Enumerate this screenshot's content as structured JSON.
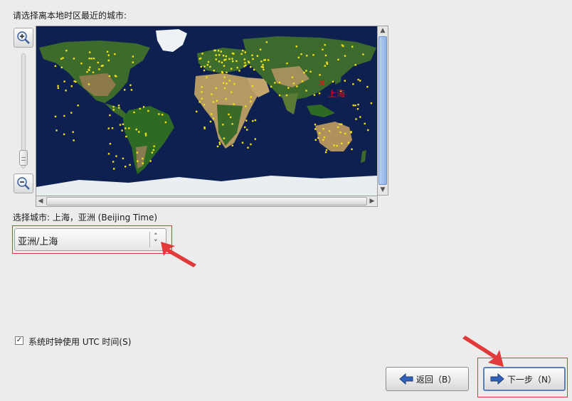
{
  "prompt": "请选择离本地时区最近的城市:",
  "map": {
    "selected_marker": "x",
    "selected_city_label": "上海"
  },
  "selected_city": {
    "label": "选择城市: 上海，亚洲 (Beijing Time)"
  },
  "city_dropdown": {
    "value": "亚洲/上海"
  },
  "utc_checkbox": {
    "checked": true,
    "checkmark": "✓",
    "label": "系统时钟使用 UTC 时间(S)"
  },
  "buttons": {
    "back_label": "返回（B）",
    "next_label": "下一步（N）"
  },
  "icons": {
    "zoom_in": "magnifier-plus-icon",
    "zoom_out": "magnifier-minus-icon",
    "back": "arrow-left-icon",
    "next": "arrow-right-icon"
  },
  "colors": {
    "annotation_red": "#e23a3a",
    "city_dot": "#f3e21b",
    "selected_city_text": "#d11a1a"
  }
}
